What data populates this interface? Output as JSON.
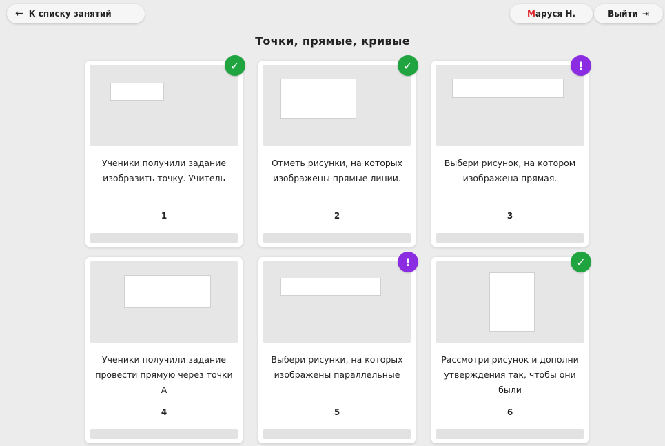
{
  "header": {
    "back_label": "К списку занятий",
    "user_first_letter": "М",
    "user_rest": "аруся Н.",
    "logout_label": "Выйти"
  },
  "page": {
    "title": "Точки, прямые, кривые"
  },
  "cards": [
    {
      "text": "Ученики получили задание изобразить точку. Учитель",
      "number": "1",
      "status": "done"
    },
    {
      "text": "Отметь рисунки, на которых изображены прямые линии.",
      "number": "2",
      "status": "done"
    },
    {
      "text": "Выбери рисунок, на котором изображена прямая.",
      "number": "3",
      "status": "warning"
    },
    {
      "text": "Ученики получили задание провести прямую через точки A",
      "number": "4",
      "status": "none"
    },
    {
      "text": "Выбери рисунки, на которых изображены параллельные",
      "number": "5",
      "status": "warning"
    },
    {
      "text": "Рассмотри рисунок и дополни утверждения так, чтобы они были",
      "number": "6",
      "status": "done"
    }
  ],
  "colors": {
    "ok": "#1fa43f",
    "warning": "#8b2be2",
    "accent": "#e0242b"
  },
  "icons": {
    "back": "arrow-left-icon",
    "logout": "exit-icon",
    "done": "check-icon",
    "warning": "exclamation-icon"
  }
}
